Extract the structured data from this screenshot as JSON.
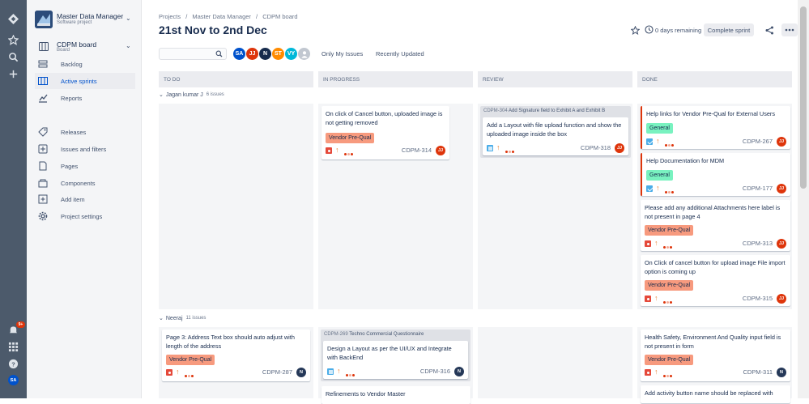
{
  "sidebar": {
    "project_name": "Master Data Manager",
    "project_type": "Software project",
    "board_name": "CDPM board",
    "board_type": "Board",
    "items": [
      {
        "label": "Backlog",
        "icon": "backlog-icon"
      },
      {
        "label": "Active sprints",
        "icon": "active-sprints-icon",
        "active": true
      },
      {
        "label": "Reports",
        "icon": "reports-icon"
      },
      {
        "label": "Releases",
        "icon": "releases-icon"
      },
      {
        "label": "Issues and filters",
        "icon": "issues-icon"
      },
      {
        "label": "Pages",
        "icon": "pages-icon"
      },
      {
        "label": "Components",
        "icon": "components-icon"
      },
      {
        "label": "Add item",
        "icon": "add-item-icon"
      },
      {
        "label": "Project settings",
        "icon": "settings-icon"
      }
    ]
  },
  "global_nav": {
    "notification_badge": "9+",
    "user_initials": "SA"
  },
  "header": {
    "breadcrumbs": [
      "Projects",
      "/",
      "Master Data Manager",
      "/",
      "CDPM board"
    ],
    "title": "21st Nov to 2nd Dec",
    "days_remaining": "0 days remaining",
    "complete_sprint": "Complete sprint"
  },
  "filters": {
    "search_placeholder": "",
    "avatars": [
      {
        "initials": "SA",
        "color": "#0052cc"
      },
      {
        "initials": "JJ",
        "color": "#de350b"
      },
      {
        "initials": "N",
        "color": "#172b4d"
      },
      {
        "initials": "ST",
        "color": "#ff8b00"
      },
      {
        "initials": "VY",
        "color": "#00b8d9"
      }
    ],
    "only_my_issues": "Only My Issues",
    "recently_updated": "Recently Updated"
  },
  "columns": [
    "TO DO",
    "IN PROGRESS",
    "REVIEW",
    "DONE"
  ],
  "swimlanes": [
    {
      "name": "Jagan kumar J",
      "count": "6 issues"
    },
    {
      "name": "Neeraj",
      "count": "11 issues"
    }
  ],
  "cards": {
    "c314": {
      "title": "On click of Cancel button, uploaded image is not getting removed",
      "epic": "Vendor Pre-Qual",
      "key": "CDPM-314",
      "assignee": "JJ"
    },
    "p304": {
      "key": "CDPM-304",
      "title": "Add Signature field to Exhibit A and Exhibit B"
    },
    "c318": {
      "title": "Add a Layout with file upload function and show the uploaded image inside the box",
      "key": "CDPM-318",
      "assignee": "JJ"
    },
    "c267": {
      "title": "Help links for Vendor Pre-Qual for External Users",
      "epic": "General",
      "key": "CDPM-267",
      "assignee": "JJ"
    },
    "c177": {
      "title": "Help Documentation for MDM",
      "epic": "General",
      "key": "CDPM-177",
      "assignee": "JJ"
    },
    "c313": {
      "title": "Please add any additional Attachments here label is not present in page 4",
      "epic": "Vendor Pre-Qual",
      "key": "CDPM-313",
      "assignee": "JJ"
    },
    "c315": {
      "title": "On Click of cancel button for upload image File import option is coming up",
      "epic": "Vendor Pre-Qual",
      "key": "CDPM-315",
      "assignee": "JJ"
    },
    "c287": {
      "title": "Page 3: Address Text box should auto adjust with length of the address",
      "epic": "Vendor Pre-Qual",
      "key": "CDPM-287",
      "assignee": "N"
    },
    "p269": {
      "key": "CDPM-269",
      "title": "Techno Commercial Questionnaire"
    },
    "c316": {
      "title": "Design a Layout as per the UI/UX and Integrate with BackEnd",
      "key": "CDPM-316",
      "assignee": "N"
    },
    "c311": {
      "title": "Health Safety, Environment And Quality input field is not present in form",
      "epic": "Vendor Pre-Qual",
      "key": "CDPM-311",
      "assignee": "N"
    },
    "c_ref": {
      "title": "Refinements to Vendor Master"
    },
    "c_add": {
      "title": "Add activity button name should be replaced with"
    }
  }
}
